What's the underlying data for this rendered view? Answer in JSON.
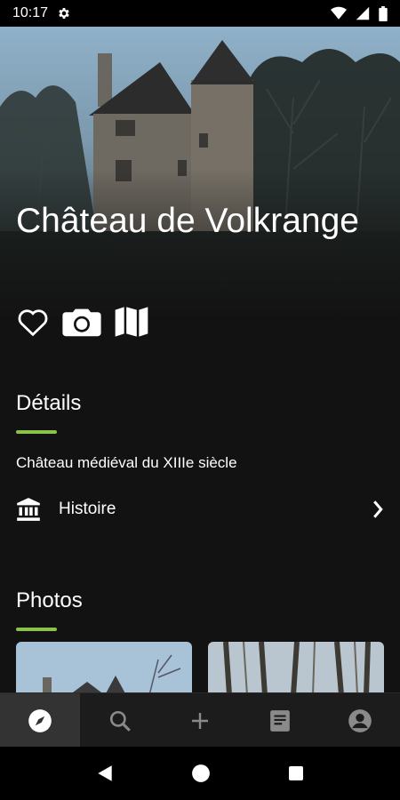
{
  "status_bar": {
    "time": "10:17"
  },
  "place": {
    "title": "Château de Volkrange"
  },
  "details": {
    "heading": "Détails",
    "description": "Château médiéval du XIIIe siècle",
    "history_label": "Histoire"
  },
  "photos": {
    "heading": "Photos"
  },
  "colors": {
    "accent": "#8bc34a",
    "background": "#121212",
    "nav_background": "#1c1c1c"
  },
  "icons": {
    "actions": [
      "heart-outline-icon",
      "camera-icon",
      "map-icon"
    ],
    "bottom_nav": [
      "compass-icon",
      "search-icon",
      "plus-icon",
      "article-icon",
      "account-icon"
    ],
    "active_tab": "compass-icon"
  }
}
